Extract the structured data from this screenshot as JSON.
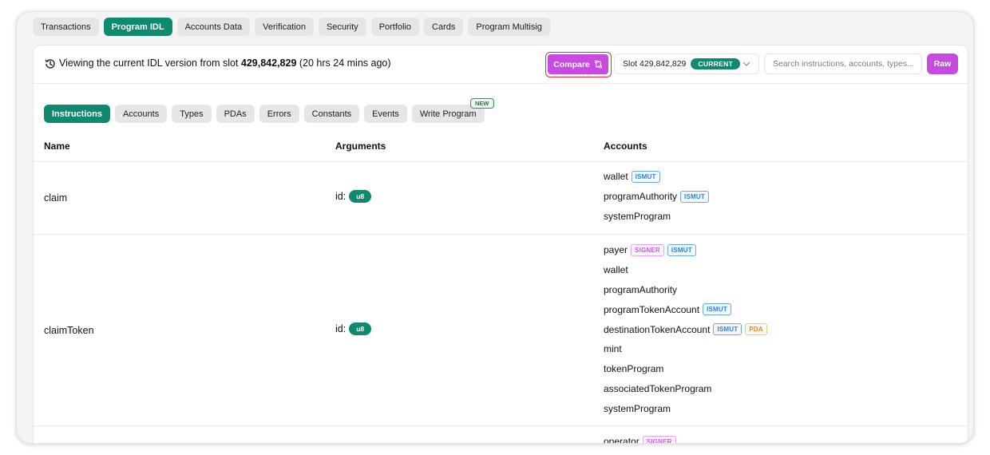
{
  "top_tabs": [
    {
      "label": "Transactions",
      "active": false
    },
    {
      "label": "Program IDL",
      "active": true
    },
    {
      "label": "Accounts Data",
      "active": false
    },
    {
      "label": "Verification",
      "active": false
    },
    {
      "label": "Security",
      "active": false
    },
    {
      "label": "Portfolio",
      "active": false
    },
    {
      "label": "Cards",
      "active": false
    },
    {
      "label": "Program Multisig",
      "active": false
    }
  ],
  "version": {
    "prefix": "Viewing the current IDL version from slot",
    "slot": "429,842,829",
    "age": "(20 hrs 24 mins ago)"
  },
  "toolbar": {
    "compare_label": "Compare",
    "slot_label": "Slot 429,842,829",
    "current_badge": "CURRENT",
    "search_placeholder": "Search instructions, accounts, types...",
    "raw_label": "Raw"
  },
  "sub_tabs": [
    {
      "label": "Instructions",
      "active": true
    },
    {
      "label": "Accounts",
      "active": false
    },
    {
      "label": "Types",
      "active": false
    },
    {
      "label": "PDAs",
      "active": false
    },
    {
      "label": "Errors",
      "active": false
    },
    {
      "label": "Constants",
      "active": false
    },
    {
      "label": "Events",
      "active": false
    },
    {
      "label": "Write Program",
      "active": false,
      "badge": "NEW"
    }
  ],
  "table": {
    "headers": {
      "name": "Name",
      "arguments": "Arguments",
      "accounts": "Accounts"
    },
    "rows": [
      {
        "name": "claim",
        "arg_label": "id:",
        "arg_type": "u8",
        "accounts": [
          {
            "name": "wallet",
            "tags": [
              "ISMUT"
            ]
          },
          {
            "name": "programAuthority",
            "tags": [
              "ISMUT"
            ]
          },
          {
            "name": "systemProgram",
            "tags": []
          }
        ]
      },
      {
        "name": "claimToken",
        "arg_label": "id:",
        "arg_type": "u8",
        "accounts": [
          {
            "name": "payer",
            "tags": [
              "SIGNER",
              "ISMUT"
            ]
          },
          {
            "name": "wallet",
            "tags": []
          },
          {
            "name": "programAuthority",
            "tags": []
          },
          {
            "name": "programTokenAccount",
            "tags": [
              "ISMUT"
            ]
          },
          {
            "name": "destinationTokenAccount",
            "tags": [
              "ISMUT",
              "PDA"
            ]
          },
          {
            "name": "mint",
            "tags": []
          },
          {
            "name": "tokenProgram",
            "tags": []
          },
          {
            "name": "associatedTokenProgram",
            "tags": []
          },
          {
            "name": "systemProgram",
            "tags": []
          }
        ]
      },
      {
        "name": "",
        "arg_label": "",
        "arg_type": "",
        "accounts": [
          {
            "name": "operator",
            "tags": [
              "SIGNER"
            ]
          }
        ]
      }
    ]
  },
  "colors": {
    "accent_green": "#0f8a6e",
    "accent_purple": "#c84ae0",
    "highlight_red": "#e0303a"
  }
}
